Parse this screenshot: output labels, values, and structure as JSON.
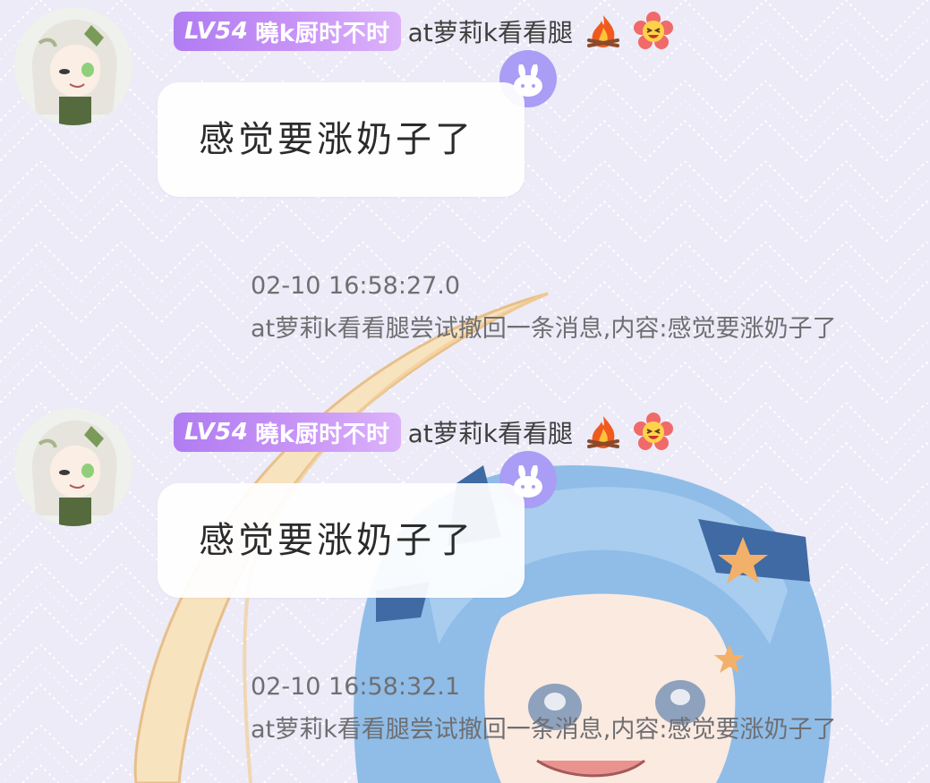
{
  "messages": [
    {
      "badge_level": "LV54",
      "badge_title": "曉k厨时不时",
      "nickname": "at萝莉k看看腿",
      "emojis": [
        "fire-emoji",
        "laughing-flower-emoji"
      ],
      "pet_icon": "rabbit-icon",
      "text": "感觉要涨奶子了"
    },
    {
      "badge_level": "LV54",
      "badge_title": "曉k厨时不时",
      "nickname": "at萝莉k看看腿",
      "emojis": [
        "fire-emoji",
        "laughing-flower-emoji"
      ],
      "pet_icon": "rabbit-icon",
      "text": "感觉要涨奶子了"
    }
  ],
  "system_notices": [
    {
      "time": "02-10 16:58:27.0",
      "text": "at萝莉k看看腿尝试撤回一条消息,内容:感觉要涨奶子了"
    },
    {
      "time": "02-10 16:58:32.1",
      "text": "at萝莉k看看腿尝试撤回一条消息,内容:感觉要涨奶子了"
    }
  ],
  "colors": {
    "background": "#ecebf7",
    "badge_start": "#b07cf2",
    "badge_end": "#dcb3fa",
    "pet_icon": "#a99df5",
    "bubble": "#ffffff",
    "notice_text": "#6f6f72"
  }
}
